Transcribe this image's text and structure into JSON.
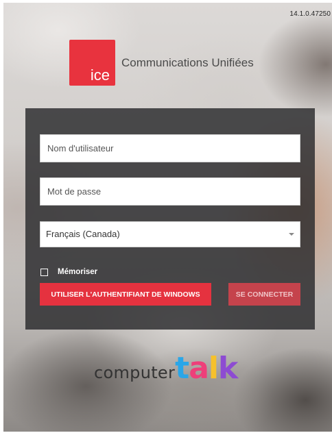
{
  "version": "14.1.0.47250",
  "logo": {
    "text": "ice",
    "color": "#e8333e"
  },
  "app_title": "Communications Unifiées",
  "form": {
    "username_placeholder": "Nom d'utilisateur",
    "password_placeholder": "Mot de passe",
    "language_selected": "Français (Canada)",
    "remember_label": "Mémoriser",
    "remember_checked": false,
    "windows_auth_button": "UTILISER L'AUTHENTIFIANT DE WINDOWS",
    "connect_button": "SE CONNECTER"
  },
  "brand": {
    "computer": "computer",
    "talk_letters": [
      "t",
      "a",
      "l",
      "k"
    ],
    "talk_colors": [
      "#2aa6e8",
      "#ee3f7a",
      "#f6c12c",
      "#8d4bd2"
    ]
  },
  "colors": {
    "accent": "#e5323f",
    "panel": "#2a2a2c"
  }
}
